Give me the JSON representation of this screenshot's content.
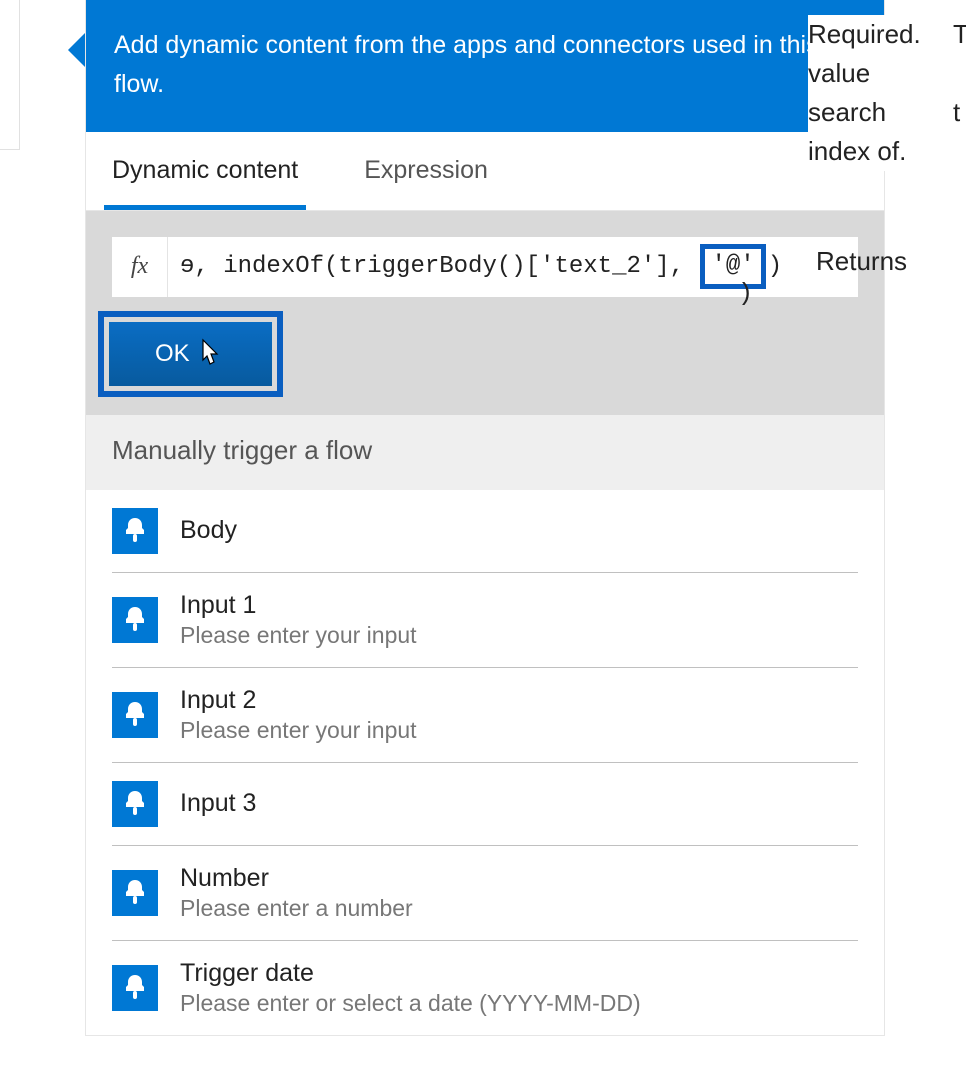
{
  "banner": {
    "text": "Add dynamic content from the apps and connectors used in this flow."
  },
  "tabs": {
    "dynamic": "Dynamic content",
    "expression": "Expression"
  },
  "fx": {
    "label": "fx",
    "expr_left": "ɘ, indexOf(triggerBody()['text_2'], ",
    "expr_highlight": "'@'",
    "expr_right": ")"
  },
  "ok": {
    "label": "OK"
  },
  "section": {
    "title": "Manually trigger a flow"
  },
  "items": [
    {
      "title": "Body",
      "desc": ""
    },
    {
      "title": "Input 1",
      "desc": "Please enter your input"
    },
    {
      "title": "Input 2",
      "desc": "Please enter your input"
    },
    {
      "title": "Input 3",
      "desc": ""
    },
    {
      "title": "Number",
      "desc": "Please enter a number"
    },
    {
      "title": "Trigger date",
      "desc": "Please enter or select a date (YYYY-MM-DD)"
    }
  ],
  "tooltip": {
    "line1a": "Required.",
    "line1b": "T",
    "line2a": "value",
    "line3a": "search",
    "line3b": "t",
    "line4a": "index of.",
    "returns": "Returns"
  },
  "trail": {
    "paren": ")"
  }
}
